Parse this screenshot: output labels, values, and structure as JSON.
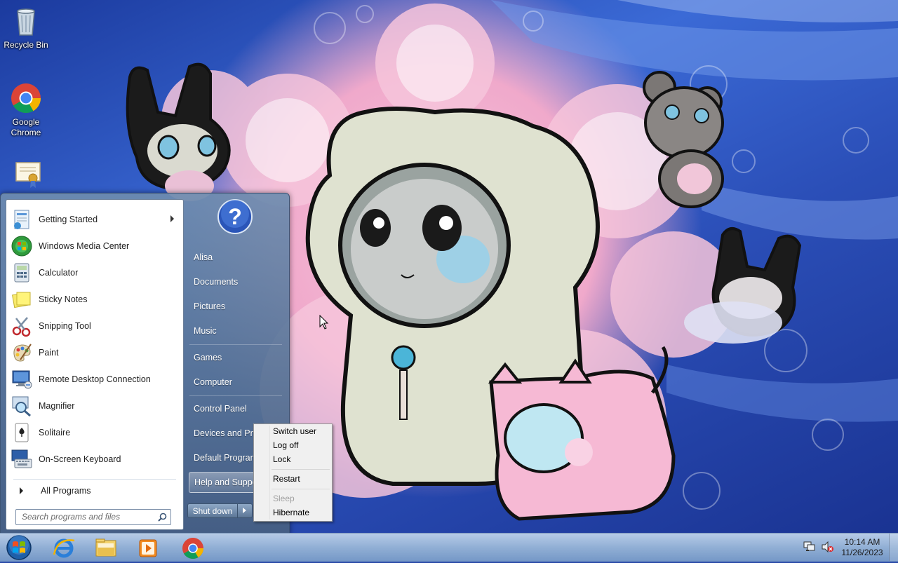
{
  "desktop": {
    "icons": [
      {
        "label": "Recycle Bin",
        "icon": "recycle-bin-icon"
      },
      {
        "label": "Google Chrome",
        "icon": "chrome-icon"
      },
      {
        "label": "",
        "icon": "certificate-icon"
      }
    ]
  },
  "start_menu": {
    "programs": [
      {
        "label": "Getting Started",
        "icon": "getting-started-icon",
        "has_submenu": true
      },
      {
        "label": "Windows Media Center",
        "icon": "media-center-icon"
      },
      {
        "label": "Calculator",
        "icon": "calculator-icon"
      },
      {
        "label": "Sticky Notes",
        "icon": "sticky-notes-icon"
      },
      {
        "label": "Snipping Tool",
        "icon": "snipping-tool-icon"
      },
      {
        "label": "Paint",
        "icon": "paint-icon"
      },
      {
        "label": "Remote Desktop Connection",
        "icon": "remote-desktop-icon"
      },
      {
        "label": "Magnifier",
        "icon": "magnifier-icon"
      },
      {
        "label": "Solitaire",
        "icon": "solitaire-icon"
      },
      {
        "label": "On-Screen Keyboard",
        "icon": "keyboard-icon"
      }
    ],
    "all_programs": "All Programs",
    "search_placeholder": "Search programs and files",
    "right_items": [
      {
        "label": "Alisa"
      },
      {
        "label": "Documents"
      },
      {
        "label": "Pictures"
      },
      {
        "label": "Music"
      },
      {
        "label": "Games"
      },
      {
        "label": "Computer"
      },
      {
        "label": "Control Panel"
      },
      {
        "label": "Devices and Printers"
      },
      {
        "label": "Default Programs"
      },
      {
        "label": "Help and Support",
        "highlighted": true
      }
    ],
    "shutdown_label": "Shut down"
  },
  "power_menu": {
    "items": [
      {
        "label": "Switch user",
        "enabled": true
      },
      {
        "label": "Log off",
        "enabled": true
      },
      {
        "label": "Lock",
        "enabled": true
      },
      {
        "label": "Restart",
        "enabled": true
      },
      {
        "label": "Sleep",
        "enabled": false
      },
      {
        "label": "Hibernate",
        "enabled": true
      }
    ]
  },
  "taskbar": {
    "pinned": [
      {
        "icon": "internet-explorer-icon"
      },
      {
        "icon": "file-explorer-icon"
      },
      {
        "icon": "media-player-icon"
      },
      {
        "icon": "chrome-icon"
      }
    ],
    "clock": {
      "time": "10:14 AM",
      "date": "11/26/2023"
    }
  },
  "colors": {
    "accent": "#3a6ad6",
    "menu_glass": "#6b86a8",
    "power_menu_bg": "#f0f0f0"
  }
}
